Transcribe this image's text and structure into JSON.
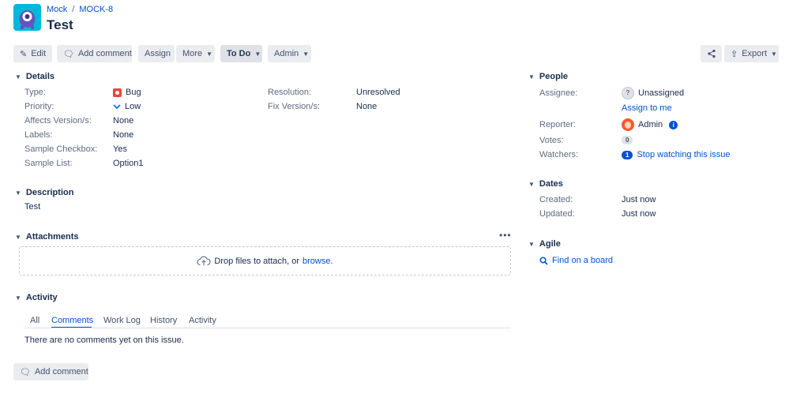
{
  "breadcrumb": {
    "project": "Mock",
    "separator": "/",
    "issue_key": "MOCK-8"
  },
  "issue": {
    "title": "Test"
  },
  "toolbar": {
    "edit": "Edit",
    "add_comment": "Add comment",
    "assign": "Assign",
    "more": "More",
    "status": "To Do",
    "admin": "Admin",
    "export": "Export"
  },
  "details": {
    "heading": "Details",
    "left": [
      {
        "label": "Type:",
        "value": "Bug"
      },
      {
        "label": "Priority:",
        "value": "Low"
      },
      {
        "label": "Affects Version/s:",
        "value": "None"
      },
      {
        "label": "Labels:",
        "value": "None"
      },
      {
        "label": "Sample Checkbox:",
        "value": "Yes"
      },
      {
        "label": "Sample List:",
        "value": "Option1"
      }
    ],
    "right": [
      {
        "label": "Resolution:",
        "value": "Unresolved"
      },
      {
        "label": "Fix Version/s:",
        "value": "None"
      }
    ]
  },
  "description": {
    "heading": "Description",
    "text": "Test"
  },
  "attachments": {
    "heading": "Attachments",
    "drop_text": "Drop files to attach, or",
    "browse": "browse."
  },
  "activity": {
    "heading": "Activity",
    "tabs": [
      "All",
      "Comments",
      "Work Log",
      "History",
      "Activity"
    ],
    "active_tab": "Comments",
    "empty_text": "There are no comments yet on this issue.",
    "add_comment": "Add comment"
  },
  "people": {
    "heading": "People",
    "assignee_label": "Assignee:",
    "assignee_value": "Unassigned",
    "assign_to_me": "Assign to me",
    "reporter_label": "Reporter:",
    "reporter_value": "Admin",
    "votes_label": "Votes:",
    "votes_count": "0",
    "watchers_label": "Watchers:",
    "watchers_count": "1",
    "watch_link": "Stop watching this issue"
  },
  "dates": {
    "heading": "Dates",
    "created_label": "Created:",
    "created_value": "Just now",
    "updated_label": "Updated:",
    "updated_value": "Just now"
  },
  "agile": {
    "heading": "Agile",
    "find_link": "Find on a board"
  },
  "colors": {
    "link": "#0052cc",
    "bug": "#e5493a",
    "priority_low": "#0065ff",
    "button_bg": "#ebecf0"
  }
}
